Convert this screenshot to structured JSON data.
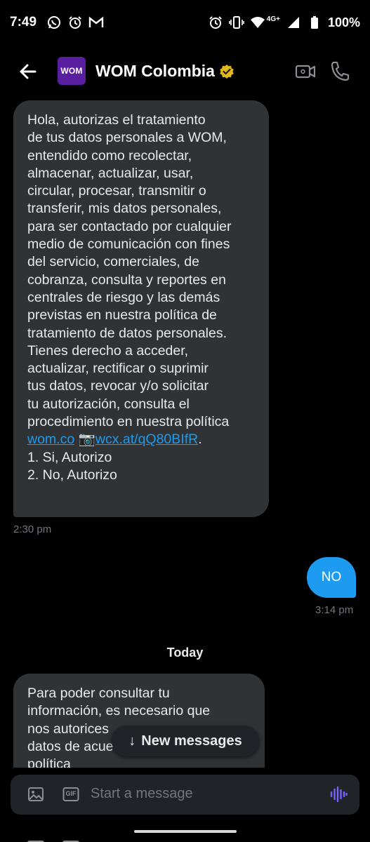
{
  "status_bar": {
    "time": "7:49",
    "network": "4G+",
    "battery": "100%"
  },
  "header": {
    "avatar_text": "WOM",
    "title": "WOM Colombia"
  },
  "messages": {
    "msg1": {
      "lines": [
        "Hola, autorizas el tratamiento",
        "de tus datos personales a WOM,",
        "entendido como recolectar,",
        "almacenar, actualizar, usar,",
        "circular, procesar, transmitir o",
        "transferir, mis datos personales,",
        "para ser contactado por cualquier",
        "medio de comunicación con fines",
        "del servicio, comerciales, de",
        "cobranza, consulta y reportes en",
        "centrales de riesgo y las demás",
        "previstas en nuestra política de",
        "tratamiento de datos personales.",
        "Tienes derecho a acceder,",
        "actualizar, rectificar o suprimir",
        "tus datos, revocar y/o solicitar",
        "tu autorización, consulta el",
        "procedimiento en nuestra política"
      ],
      "link1": "wom.co",
      "camera_emoji": "📷",
      "link2": "wcx.at/qQ80BIfR",
      "link_suffix": ".",
      "option1": "1. Si, Autorizo",
      "option2": "2. No, Autorizo",
      "time": "2:30 pm"
    },
    "reply": {
      "text": "NO",
      "time": "3:14 pm"
    },
    "day_separator": "Today",
    "msg2": {
      "lines": [
        "Para poder consultar tu",
        "información, es necesario que",
        "nos autorices",
        "datos de acue",
        "política"
      ]
    }
  },
  "new_messages_pill": {
    "arrow": "↓",
    "label": "New messages"
  },
  "composer": {
    "gif_label": "GIF",
    "placeholder": "Start a message"
  },
  "colors": {
    "background": "#000000",
    "incoming_bubble": "#2f3336",
    "outgoing_bubble": "#1d9bf0",
    "link": "#1d9bf0",
    "brand_purple": "#5a1ea0",
    "verified_gold": "#e2b719",
    "mic_accent": "#7b61ff"
  }
}
